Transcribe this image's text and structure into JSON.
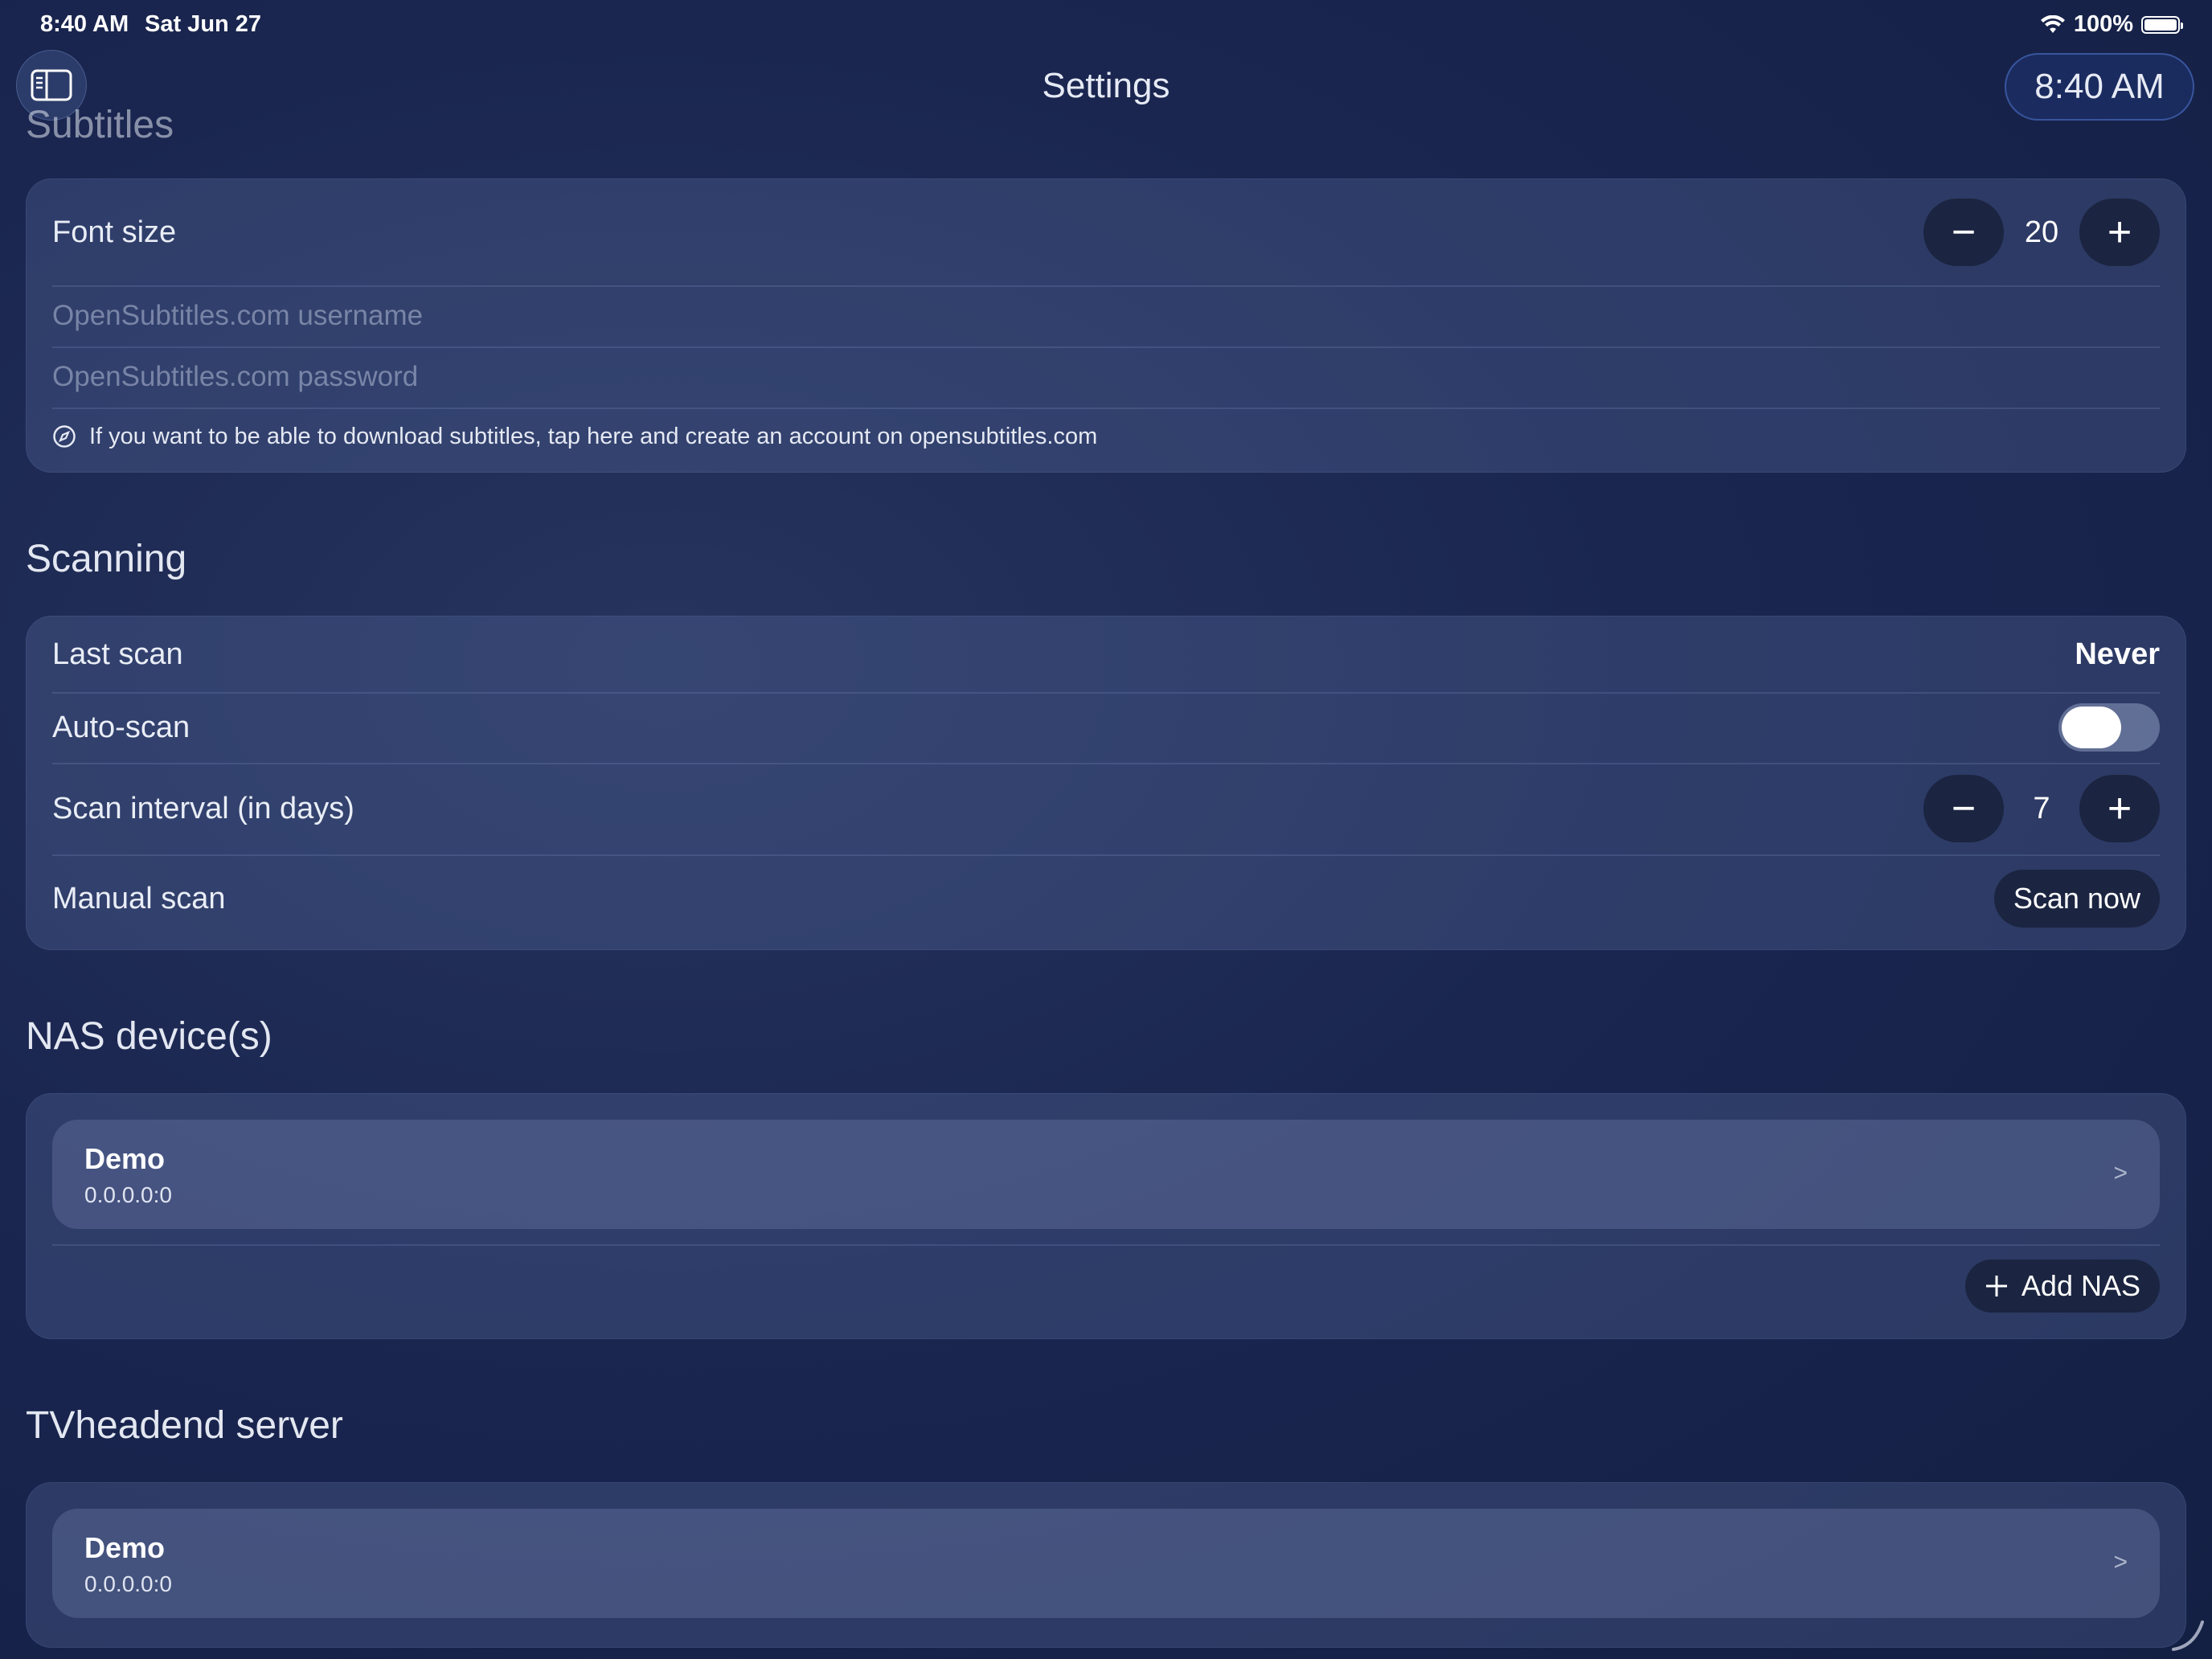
{
  "status_bar": {
    "time": "8:40 AM",
    "date": "Sat Jun 27",
    "battery": "100%",
    "wifi_icon": "wifi-icon",
    "battery_icon": "battery-icon"
  },
  "nav": {
    "title": "Settings",
    "clock": "8:40 AM",
    "sidebar_icon": "sidebar-toggle-icon"
  },
  "subtitles": {
    "title": "Subtitles",
    "font_size_label": "Font size",
    "font_size_value": "20",
    "username_placeholder": "OpenSubtitles.com username",
    "password_placeholder": "OpenSubtitles.com password",
    "info_text": "If you want to be able to download subtitles, tap here and create an account on opensubtitles.com",
    "info_icon": "compass-icon"
  },
  "scanning": {
    "title": "Scanning",
    "last_scan_label": "Last scan",
    "last_scan_value": "Never",
    "auto_scan_label": "Auto-scan",
    "auto_scan_on": false,
    "interval_label": "Scan interval (in days)",
    "interval_value": "7",
    "manual_label": "Manual scan",
    "scan_now_label": "Scan now"
  },
  "nas": {
    "title": "NAS device(s)",
    "devices": [
      {
        "name": "Demo",
        "address": "0.0.0.0:0"
      }
    ],
    "add_label": "Add NAS"
  },
  "tvheadend": {
    "title": "TVheadend server",
    "devices": [
      {
        "name": "Demo",
        "address": "0.0.0.0:0"
      }
    ]
  },
  "stepper": {
    "minus": "−",
    "plus": "+"
  },
  "chevron": ">"
}
